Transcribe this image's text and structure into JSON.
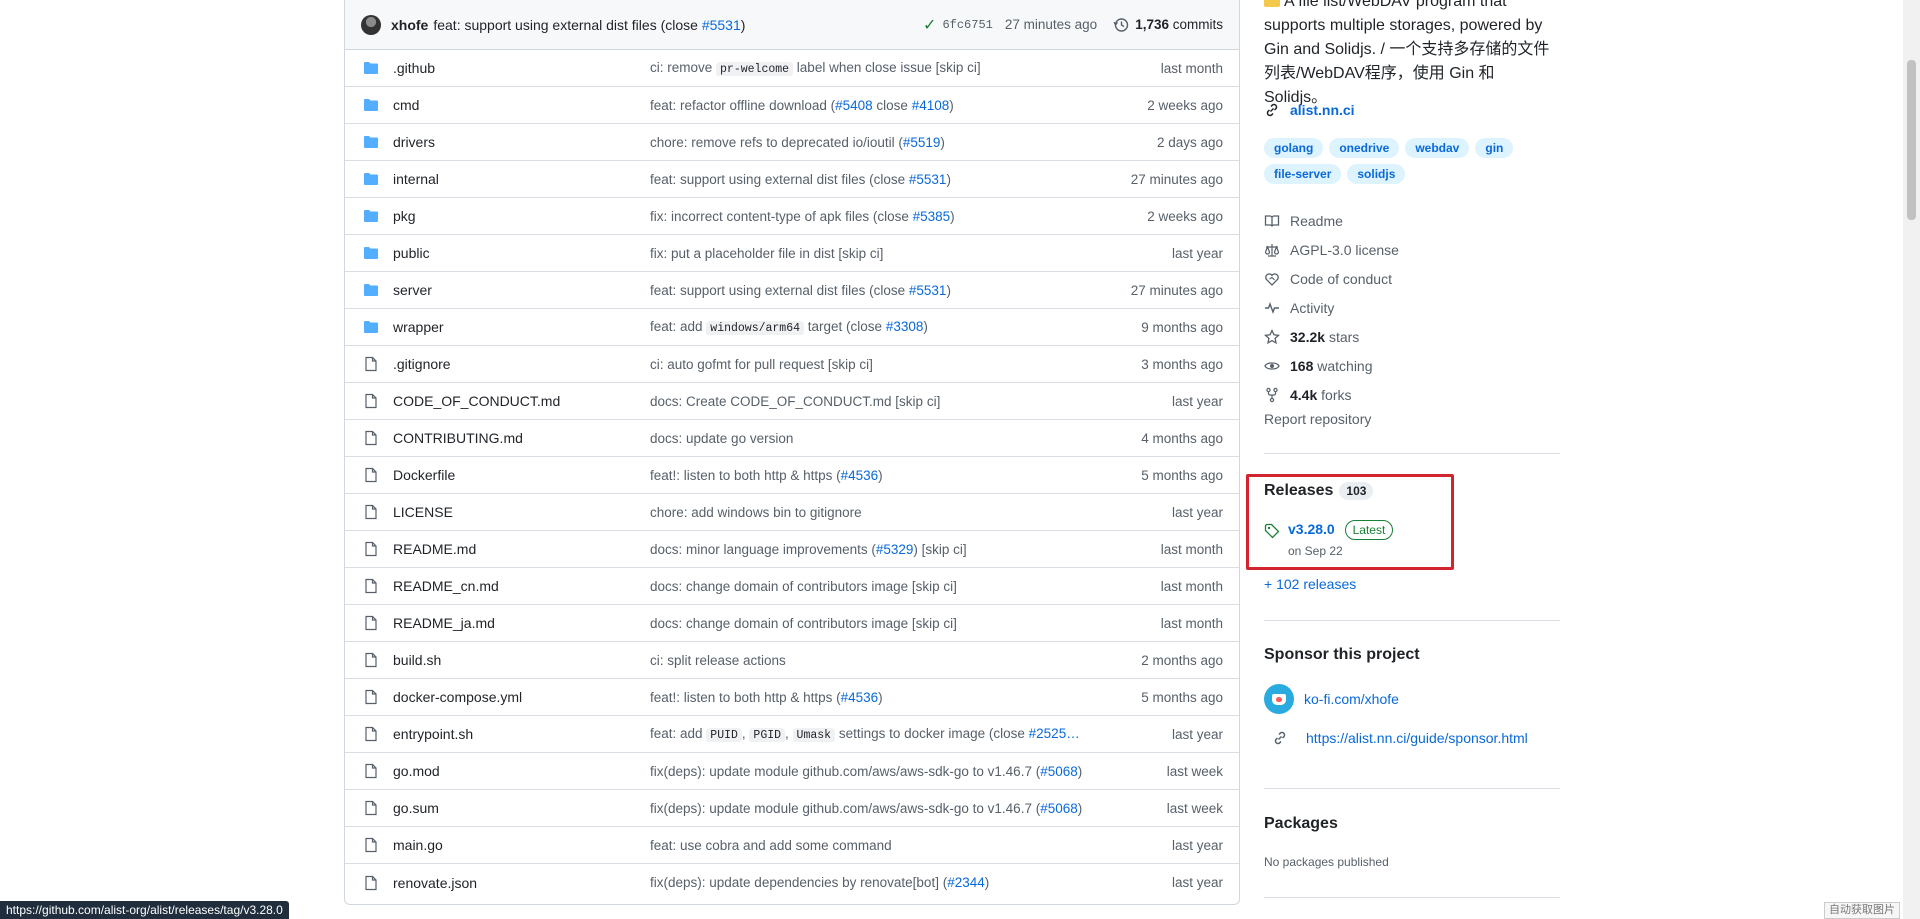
{
  "commit": {
    "author": "xhofe",
    "message": "feat: support using external dist files (close ",
    "message_link": "#5531",
    "message_end": ")",
    "sha": "6fc6751",
    "time": "27 minutes ago",
    "commits_count": "1,736",
    "commits_label": "commits"
  },
  "files": [
    {
      "type": "folder",
      "name": ".github",
      "msg": [
        {
          "t": "ci: remove "
        },
        {
          "c": "pr-welcome"
        },
        {
          "t": " label when close issue [skip ci]"
        }
      ],
      "time": "last month"
    },
    {
      "type": "folder",
      "name": "cmd",
      "msg": [
        {
          "t": "feat: refactor offline download ("
        },
        {
          "l": "#5408"
        },
        {
          "t": " close "
        },
        {
          "l": "#4108"
        },
        {
          "t": ")"
        }
      ],
      "time": "2 weeks ago"
    },
    {
      "type": "folder",
      "name": "drivers",
      "msg": [
        {
          "t": "chore: remove refs to deprecated io/ioutil ("
        },
        {
          "l": "#5519"
        },
        {
          "t": ")"
        }
      ],
      "time": "2 days ago"
    },
    {
      "type": "folder",
      "name": "internal",
      "msg": [
        {
          "t": "feat: support using external dist files (close "
        },
        {
          "l": "#5531"
        },
        {
          "t": ")"
        }
      ],
      "time": "27 minutes ago"
    },
    {
      "type": "folder",
      "name": "pkg",
      "msg": [
        {
          "t": "fix: incorrect content-type of apk files (close "
        },
        {
          "l": "#5385"
        },
        {
          "t": ")"
        }
      ],
      "time": "2 weeks ago"
    },
    {
      "type": "folder",
      "name": "public",
      "msg": [
        {
          "t": "fix: put a placeholder file in dist [skip ci]"
        }
      ],
      "time": "last year"
    },
    {
      "type": "folder",
      "name": "server",
      "msg": [
        {
          "t": "feat: support using external dist files (close "
        },
        {
          "l": "#5531"
        },
        {
          "t": ")"
        }
      ],
      "time": "27 minutes ago"
    },
    {
      "type": "folder",
      "name": "wrapper",
      "msg": [
        {
          "t": "feat: add "
        },
        {
          "c": "windows/arm64"
        },
        {
          "t": " target (close "
        },
        {
          "l": "#3308"
        },
        {
          "t": ")"
        }
      ],
      "time": "9 months ago"
    },
    {
      "type": "file",
      "name": ".gitignore",
      "msg": [
        {
          "t": "ci: auto gofmt for pull request [skip ci]"
        }
      ],
      "time": "3 months ago"
    },
    {
      "type": "file",
      "name": "CODE_OF_CONDUCT.md",
      "msg": [
        {
          "t": "docs: Create CODE_OF_CONDUCT.md [skip ci]"
        }
      ],
      "time": "last year"
    },
    {
      "type": "file",
      "name": "CONTRIBUTING.md",
      "msg": [
        {
          "t": "docs: update go version"
        }
      ],
      "time": "4 months ago"
    },
    {
      "type": "file",
      "name": "Dockerfile",
      "msg": [
        {
          "t": "feat!: listen to both http & https ("
        },
        {
          "l": "#4536"
        },
        {
          "t": ")"
        }
      ],
      "time": "5 months ago"
    },
    {
      "type": "file",
      "name": "LICENSE",
      "msg": [
        {
          "t": "chore: add windows bin to gitignore"
        }
      ],
      "time": "last year"
    },
    {
      "type": "file",
      "name": "README.md",
      "msg": [
        {
          "t": "docs: minor language improvements ("
        },
        {
          "l": "#5329"
        },
        {
          "t": ") [skip ci]"
        }
      ],
      "time": "last month"
    },
    {
      "type": "file",
      "name": "README_cn.md",
      "msg": [
        {
          "t": "docs: change domain of contributors image [skip ci]"
        }
      ],
      "time": "last month"
    },
    {
      "type": "file",
      "name": "README_ja.md",
      "msg": [
        {
          "t": "docs: change domain of contributors image [skip ci]"
        }
      ],
      "time": "last month"
    },
    {
      "type": "file",
      "name": "build.sh",
      "msg": [
        {
          "t": "ci: split release actions"
        }
      ],
      "time": "2 months ago"
    },
    {
      "type": "file",
      "name": "docker-compose.yml",
      "msg": [
        {
          "t": "feat!: listen to both http & https ("
        },
        {
          "l": "#4536"
        },
        {
          "t": ")"
        }
      ],
      "time": "5 months ago"
    },
    {
      "type": "file",
      "name": "entrypoint.sh",
      "msg": [
        {
          "t": "feat: add "
        },
        {
          "c": "PUID"
        },
        {
          "t": ", "
        },
        {
          "c": "PGID"
        },
        {
          "t": ", "
        },
        {
          "c": "Umask"
        },
        {
          "t": " settings to docker image (close "
        },
        {
          "l": "#2525…"
        }
      ],
      "time": "last year"
    },
    {
      "type": "file",
      "name": "go.mod",
      "msg": [
        {
          "t": "fix(deps): update module github.com/aws/aws-sdk-go to v1.46.7 ("
        },
        {
          "l": "#5068"
        },
        {
          "t": ")"
        }
      ],
      "time": "last week"
    },
    {
      "type": "file",
      "name": "go.sum",
      "msg": [
        {
          "t": "fix(deps): update module github.com/aws/aws-sdk-go to v1.46.7 ("
        },
        {
          "l": "#5068"
        },
        {
          "t": ")"
        }
      ],
      "time": "last week"
    },
    {
      "type": "file",
      "name": "main.go",
      "msg": [
        {
          "t": "feat: use cobra and add some command"
        }
      ],
      "time": "last year"
    },
    {
      "type": "file",
      "name": "renovate.json",
      "msg": [
        {
          "t": "fix(deps): update dependencies by renovate[bot] ("
        },
        {
          "l": "#2344"
        },
        {
          "t": ")"
        }
      ],
      "time": "last year"
    }
  ],
  "about": {
    "desc_line1": "A file list/WebDAV program that",
    "desc_line2": "supports multiple storages, powered by",
    "desc_line3": "Gin and Solidjs. / 一个支持多存储的文件",
    "desc_line4": "列表/WebDAV程序，使用 Gin 和 Solidjs。",
    "homepage": "alist.nn.ci",
    "topics": [
      "golang",
      "onedrive",
      "webdav",
      "gin",
      "file-server",
      "solidjs"
    ],
    "readme": "Readme",
    "license": "AGPL-3.0 license",
    "conduct": "Code of conduct",
    "activity": "Activity",
    "stars_count": "32.2k",
    "stars_label": "stars",
    "watching_count": "168",
    "watching_label": "watching",
    "forks_count": "4.4k",
    "forks_label": "forks",
    "report": "Report repository"
  },
  "releases": {
    "title": "Releases",
    "count": "103",
    "latest_name": "v3.28.0",
    "latest_badge": "Latest",
    "latest_date": "on Sep 22",
    "more": "+ 102 releases",
    "highlight_color": "#d1242f"
  },
  "sponsor": {
    "title": "Sponsor this project",
    "kofi": "ko-fi.com/xhofe",
    "link": "https://alist.nn.ci/guide/sponsor.html"
  },
  "packages": {
    "title": "Packages",
    "none": "No packages published"
  },
  "status_url": "https://github.com/alist-org/alist/releases/tag/v3.28.0",
  "watermark": "自动获取图片",
  "colors": {
    "folder": "#54aeff",
    "link": "#0969da",
    "success": "#1a7f37"
  }
}
